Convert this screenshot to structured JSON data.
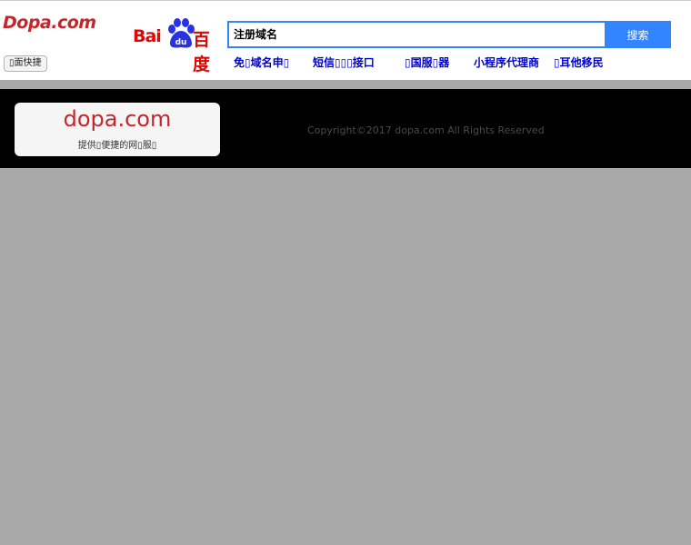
{
  "header": {
    "logo_text": "Dopa.com",
    "home_button": "▯面快捷",
    "baidu_logo": {
      "left": "Bai",
      "right": "百度",
      "paw_label": "du"
    },
    "search": {
      "value": "注册域名",
      "button": "搜索"
    },
    "nav": [
      "免▯域名申▯",
      "短信▯▯▯接口",
      "▯国服▯器",
      "小程序代理商",
      "▯耳他移民"
    ]
  },
  "banner": {
    "domain": "dopa.com",
    "tagline": "提供▯便捷的网▯服▯",
    "copyright": "Copyright©2017  dopa.com  All Rights Reserved"
  },
  "colors": {
    "brand_red": "#c1272d",
    "baidu_red": "#e10602",
    "baidu_blue": "#3385ff",
    "nav_blue": "#0000cc",
    "band": "#000000",
    "page_bg": "#a9a9a9"
  }
}
